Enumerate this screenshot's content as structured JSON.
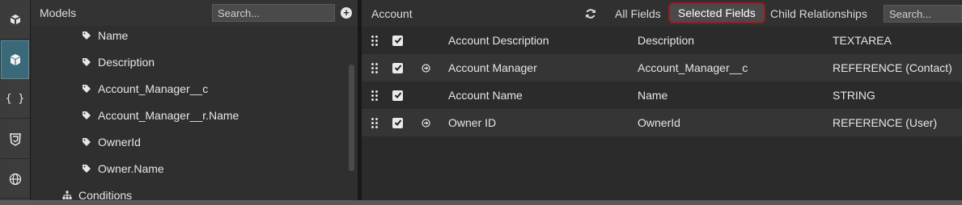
{
  "rail": {
    "items": [
      {
        "icon": "cubes-icon"
      },
      {
        "icon": "cube-icon",
        "active": true
      },
      {
        "icon": "braces-icon",
        "glyph": "{ }"
      },
      {
        "icon": "css3-icon"
      },
      {
        "icon": "globe-icon"
      }
    ]
  },
  "models": {
    "title": "Models",
    "search_placeholder": "Search...",
    "items": [
      {
        "label": "Name"
      },
      {
        "label": "Description"
      },
      {
        "label": "Account_Manager__c"
      },
      {
        "label": "Account_Manager__r.Name"
      },
      {
        "label": "OwnerId"
      },
      {
        "label": "Owner.Name"
      }
    ],
    "conditions_label": "Conditions"
  },
  "fields": {
    "title": "Account",
    "tabs": {
      "all": "All Fields",
      "selected": "Selected Fields",
      "child": "Child Relationships"
    },
    "search_placeholder": "Search...",
    "rows": [
      {
        "label": "Account Description",
        "api": "Description",
        "type": "TEXTAREA",
        "checked": true,
        "reference": false
      },
      {
        "label": "Account Manager",
        "api": "Account_Manager__c",
        "type": "REFERENCE (Contact)",
        "checked": true,
        "reference": true
      },
      {
        "label": "Account Name",
        "api": "Name",
        "type": "STRING",
        "checked": true,
        "reference": false
      },
      {
        "label": "Owner ID",
        "api": "OwnerId",
        "type": "REFERENCE (User)",
        "checked": true,
        "reference": true
      }
    ]
  },
  "colors": {
    "selected_tab_border": "#9b1b22",
    "active_rail": "#3a6a7a"
  }
}
